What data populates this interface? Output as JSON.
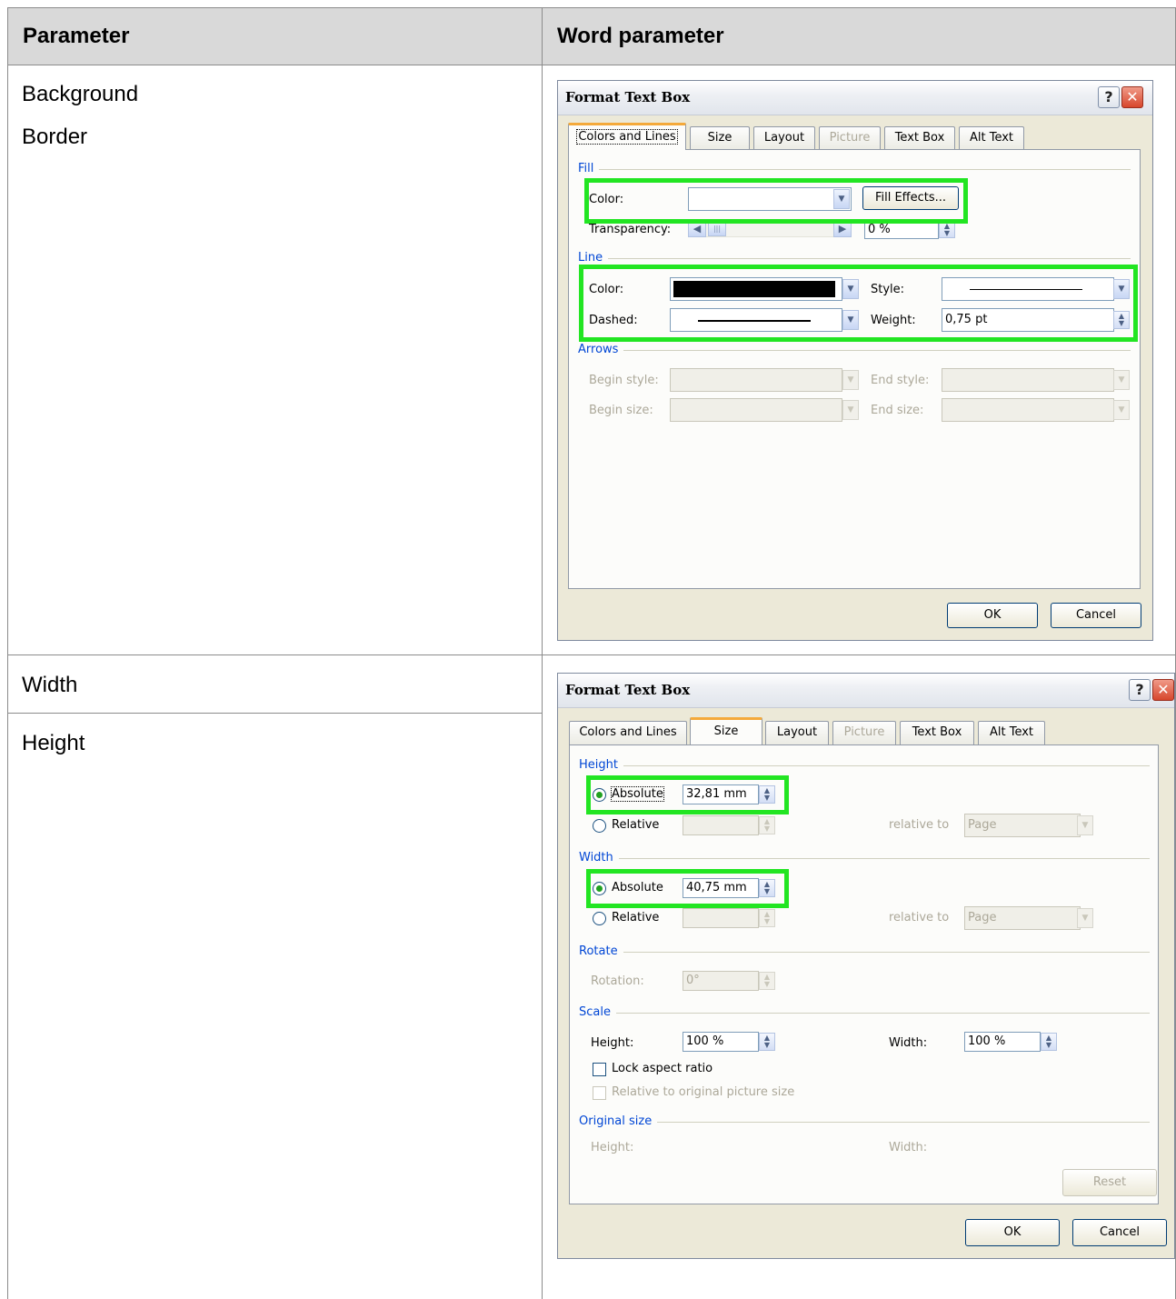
{
  "table": {
    "headers": [
      "Parameter",
      "Word parameter"
    ],
    "rows": [
      {
        "params": [
          "Background",
          "Border"
        ]
      },
      {
        "params": [
          "Width"
        ]
      },
      {
        "params": [
          "Height"
        ]
      }
    ]
  },
  "dialog1": {
    "title": "Format Text Box",
    "tabs": [
      "Colors and Lines",
      "Size",
      "Layout",
      "Picture",
      "Text Box",
      "Alt Text"
    ],
    "active_tab": "Colors and Lines",
    "fill": {
      "group": "Fill",
      "color_label": "Color:",
      "color_value": "",
      "fill_effects_button": "Fill Effects...",
      "transparency_label": "Transparency:",
      "transparency_value": "0 %"
    },
    "line": {
      "group": "Line",
      "color_label": "Color:",
      "color_value": "#000000",
      "style_label": "Style:",
      "dashed_label": "Dashed:",
      "weight_label": "Weight:",
      "weight_value": "0,75 pt"
    },
    "arrows": {
      "group": "Arrows",
      "begin_style_label": "Begin style:",
      "end_style_label": "End style:",
      "begin_size_label": "Begin size:",
      "end_size_label": "End size:"
    },
    "ok_button": "OK",
    "cancel_button": "Cancel"
  },
  "dialog2": {
    "title": "Format Text Box",
    "tabs": [
      "Colors and Lines",
      "Size",
      "Layout",
      "Picture",
      "Text Box",
      "Alt Text"
    ],
    "active_tab": "Size",
    "height": {
      "group": "Height",
      "absolute_label": "Absolute",
      "absolute_value": "32,81 mm",
      "relative_label": "Relative",
      "relative_to_label": "relative to",
      "relative_to_value": "Page"
    },
    "width": {
      "group": "Width",
      "absolute_label": "Absolute",
      "absolute_value": "40,75 mm",
      "relative_label": "Relative",
      "relative_to_label": "relative to",
      "relative_to_value": "Page"
    },
    "rotate": {
      "group": "Rotate",
      "rotation_label": "Rotation:",
      "rotation_value": "0°"
    },
    "scale": {
      "group": "Scale",
      "height_label": "Height:",
      "height_value": "100 %",
      "width_label": "Width:",
      "width_value": "100 %",
      "lock_aspect": "Lock aspect ratio",
      "relative_original": "Relative to original picture size"
    },
    "original": {
      "group": "Original size",
      "height_label": "Height:",
      "width_label": "Width:",
      "reset_button": "Reset"
    },
    "ok_button": "OK",
    "cancel_button": "Cancel"
  },
  "colors": {
    "highlight": "#22e522",
    "group_label": "#0046d5",
    "header_bg": "#d9d9d9"
  }
}
